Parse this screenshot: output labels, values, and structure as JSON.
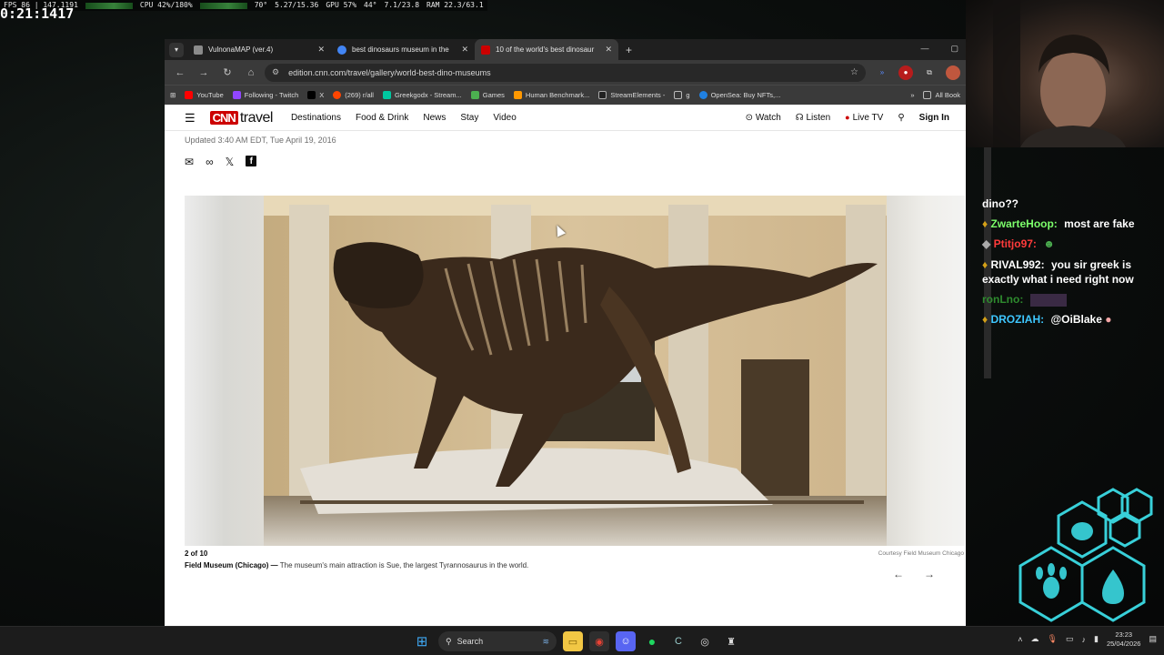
{
  "overlay": {
    "fps": "FPS 86 | 147.1191",
    "cpu": "CPU 42%/180%",
    "cpu_temp": "70°",
    "cpu_mem": "5.27/15.36",
    "gpu": "GPU 57%",
    "gpu_temp": "44°",
    "gpu_mem": "7.1/23.8",
    "ram": "RAM 22.3/63.1",
    "clock": "0:21:1417"
  },
  "browser": {
    "tabs": [
      {
        "title": "VulnonaMAP (ver.4)",
        "favicon_color": "#8a8a8a",
        "active": false
      },
      {
        "title": "best dinosaurs museum in the",
        "favicon_color": "#4285f4",
        "active": false
      },
      {
        "title": "10 of the world's best dinosaur",
        "favicon_color": "#cc0000",
        "active": true
      }
    ],
    "url": "edition.cnn.com/travel/gallery/world-best-dino-museums",
    "bookmarks": [
      {
        "label": "YouTube",
        "color": "#ff0000"
      },
      {
        "label": "Following - Twitch",
        "color": "#9146ff"
      },
      {
        "label": "X",
        "color": "#000000"
      },
      {
        "label": "(269) r/all",
        "color": "#ff4500"
      },
      {
        "label": "Greekgodx - Stream...",
        "color": "#00c8a0"
      },
      {
        "label": "Games",
        "color": "#4caf50"
      },
      {
        "label": "Human Benchmark...",
        "color": "#ff9800"
      },
      {
        "label": "StreamElements -",
        "color": "#222222"
      },
      {
        "label": "g",
        "color": "#5f6368"
      },
      {
        "label": "OpenSea: Buy NFTs,...",
        "color": "#2081e2"
      }
    ],
    "all_bookmarks": "All Book"
  },
  "cnn": {
    "brand": "CNN",
    "section": "travel",
    "nav": [
      "Destinations",
      "Food & Drink",
      "News",
      "Stay",
      "Video"
    ],
    "watch": "Watch",
    "listen": "Listen",
    "live_tv": "Live TV",
    "sign_in": "Sign In",
    "updated": "Updated 3:40 AM EDT, Tue April 19, 2016",
    "gallery": {
      "counter": "2 of 10",
      "credit": "Courtesy Field Museum Chicago",
      "caption_title": "Field Museum (Chicago) —",
      "caption_text": "The museum's main attraction is Sue, the largest Tyrannosaurus in the world."
    }
  },
  "chat": [
    {
      "user": "",
      "text": "dino??",
      "color": "#ffffff"
    },
    {
      "user": "ZwarteHoop:",
      "text": "most are fake",
      "color": "#7cff6b"
    },
    {
      "user": "Ptitjo97:",
      "text": "",
      "color": "#ff3b3b"
    },
    {
      "user": "RIVAL992:",
      "text": "you sir greek is exactly what i need right now",
      "color": "#ffffff"
    },
    {
      "user": "ronLno:",
      "text": "",
      "color": "#2e8b2e"
    },
    {
      "user": "DROZIAH:",
      "text": "@OiBlake",
      "color": "#3ec7ff"
    }
  ],
  "taskbar": {
    "search": "Search",
    "time": "23:23",
    "date": "25/04/2026"
  }
}
